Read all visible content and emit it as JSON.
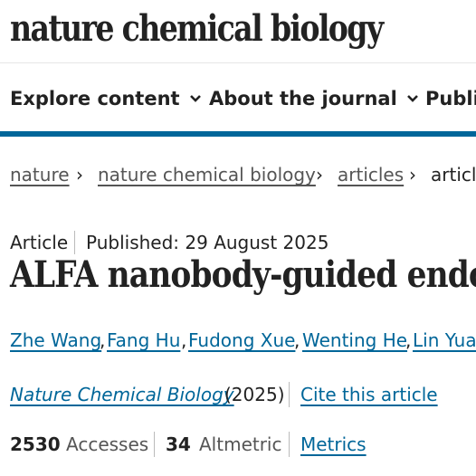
{
  "header": {
    "logo_text": "nature chemical biology"
  },
  "nav": {
    "items": [
      {
        "label": "Explore content"
      },
      {
        "label": "About the journal"
      },
      {
        "label": "Publis"
      }
    ]
  },
  "breadcrumb": {
    "items": [
      "nature",
      "nature chemical biology",
      "articles"
    ],
    "current": "article"
  },
  "article": {
    "type": "Article",
    "published": "Published: 29 August 2025",
    "title": "ALFA nanobody-guided endo",
    "authors": [
      "Zhe Wang",
      "Fang Hu",
      "Fudong Xue",
      "Wenting He",
      "Lin Yua"
    ],
    "journal": "Nature Chemical Biology",
    "year": "(2025)",
    "cite_label": "Cite this article"
  },
  "metrics": {
    "accesses_value": "2530",
    "accesses_label": "Accesses",
    "altmetric_value": "34",
    "altmetric_label": "Altmetric",
    "metrics_link": "Metrics"
  },
  "colors": {
    "accent": "#006699",
    "text": "#222222",
    "muted": "#555555"
  }
}
